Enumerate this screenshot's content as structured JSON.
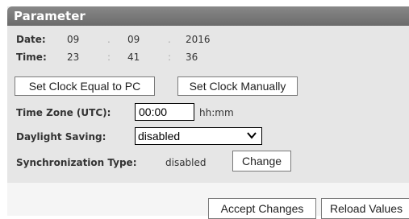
{
  "panel": {
    "title": "Parameter"
  },
  "date": {
    "label": "Date:",
    "day": "09",
    "month": "09",
    "year": "2016",
    "sep": "."
  },
  "time": {
    "label": "Time:",
    "hour": "23",
    "minute": "41",
    "second": "36",
    "sep": ":"
  },
  "buttons": {
    "set_clock_pc": "Set Clock Equal to PC",
    "set_clock_manual": "Set Clock Manually",
    "change": "Change",
    "accept": "Accept Changes",
    "reload": "Reload Values"
  },
  "timezone": {
    "label": "Time Zone (UTC):",
    "value": "00:00",
    "unit": "hh:mm"
  },
  "daylight": {
    "label": "Daylight Saving:",
    "selected": "disabled"
  },
  "sync": {
    "label": "Synchronization Type:",
    "value": "disabled"
  }
}
